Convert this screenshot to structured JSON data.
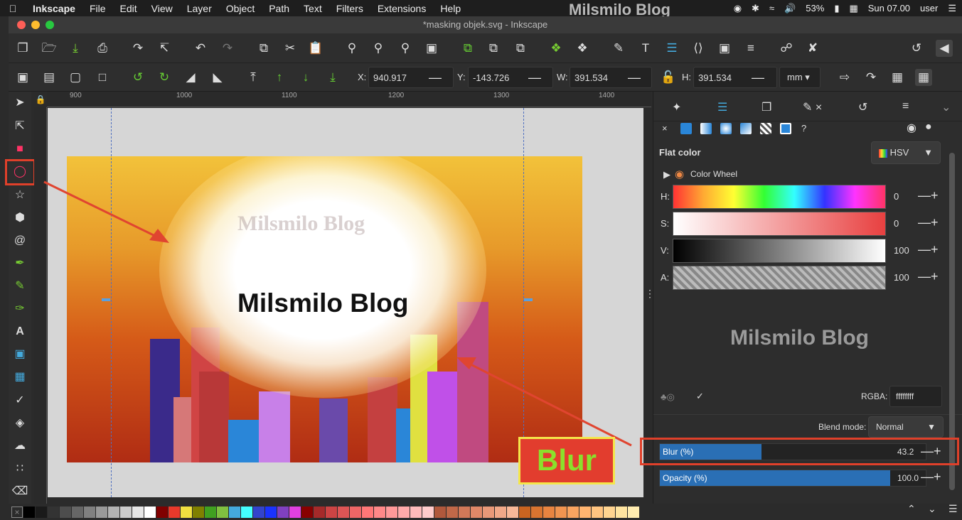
{
  "menubar": {
    "app": "Inkscape",
    "items": [
      "File",
      "Edit",
      "View",
      "Layer",
      "Object",
      "Path",
      "Text",
      "Filters",
      "Extensions",
      "Help"
    ],
    "watermark": "Milsmilo Blog",
    "battery": "53%",
    "clock": "Sun 07.00",
    "user": "user"
  },
  "window": {
    "title": "*masking objek.svg - Inkscape"
  },
  "toolbar2": {
    "x_label": "X:",
    "x_value": "940.917",
    "y_label": "Y:",
    "y_value": "-143.726",
    "w_label": "W:",
    "w_value": "391.534",
    "h_label": "H:",
    "h_value": "391.534",
    "unit": "mm"
  },
  "ruler": {
    "h_ticks": [
      "900",
      "1000",
      "1100",
      "1200",
      "1300",
      "1400"
    ]
  },
  "canvas": {
    "faded_watermark": "Milsmilo Blog",
    "title": "Milsmilo Blog"
  },
  "panel": {
    "flat_color_label": "Flat color",
    "mode_select": "HSV",
    "color_wheel_label": "Color Wheel",
    "sliders": [
      {
        "label": "H:",
        "value": "0"
      },
      {
        "label": "S:",
        "value": "0"
      },
      {
        "label": "V:",
        "value": "100"
      },
      {
        "label": "A:",
        "value": "100"
      }
    ],
    "big_watermark": "Milsmilo Blog",
    "rgba_label": "RGBA:",
    "rgba_value": "ffffffff",
    "blend_label": "Blend mode:",
    "blend_value": "Normal",
    "blur_label": "Blur (%)",
    "blur_value": "43.2",
    "blur_fraction": 0.432,
    "opacity_label": "Opacity (%)",
    "opacity_value": "100.0",
    "opacity_fraction": 1.0
  },
  "annotation": {
    "callout": "Blur"
  },
  "colors": {
    "accent": "#2a6fb5",
    "highlight": "#e0402a"
  }
}
